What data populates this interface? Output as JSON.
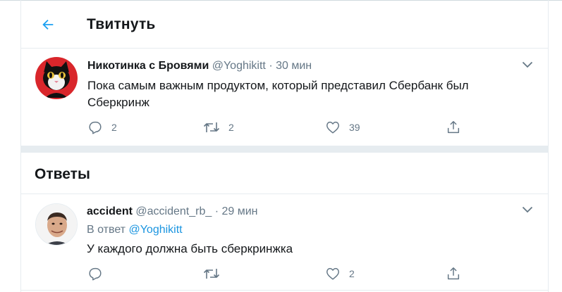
{
  "header": {
    "title": "Твитнуть"
  },
  "tweet": {
    "name": "Никотинка с Бровями",
    "handle": "@Yoghikitt",
    "dot": "·",
    "time": "30 мин",
    "text_line1": "Пока самым важным продуктом, который представил Сбербанк был",
    "text_line2": "Сберкринж",
    "reply_count": "2",
    "retweet_count": "2",
    "like_count": "39"
  },
  "answers": {
    "title": "Ответы"
  },
  "reply": {
    "name": "accident",
    "handle": "@accident_rb_",
    "dot": "·",
    "time": "29 мин",
    "reply_to_prefix": "В ответ",
    "reply_to_handle": "@Yoghikitt",
    "text": "У каждого должна быть сберкринжка",
    "like_count": "2"
  },
  "colors": {
    "accent": "#1da1f2",
    "muted": "#657786",
    "divider": "#e6ecf0"
  },
  "icons": [
    "back-arrow-icon",
    "chevron-down-icon",
    "reply-icon",
    "retweet-icon",
    "like-icon",
    "share-icon"
  ]
}
